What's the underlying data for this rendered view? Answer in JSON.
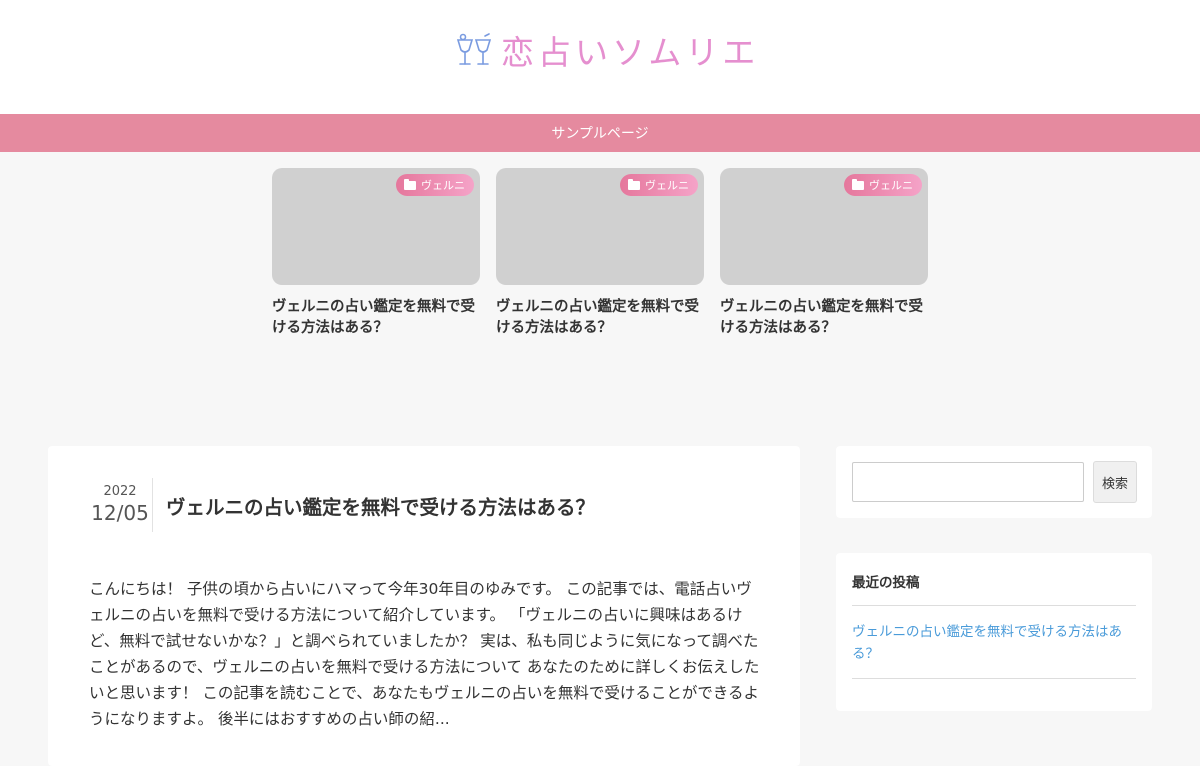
{
  "header": {
    "logo_text": "恋占いソムリエ",
    "logo_icon": "wine-glasses-icon",
    "logo_color": "#e58fcf"
  },
  "nav": {
    "items": [
      {
        "label": "サンプルページ"
      }
    ],
    "background": "#e58a9f"
  },
  "pickup": {
    "cards": [
      {
        "category": "ヴェルニ",
        "title": "ヴェルニの占い鑑定を無料で受ける方法はある？"
      },
      {
        "category": "ヴェルニ",
        "title": "ヴェルニの占い鑑定を無料で受ける方法はある？"
      },
      {
        "category": "ヴェルニ",
        "title": "ヴェルニの占い鑑定を無料で受ける方法はある？"
      }
    ]
  },
  "article": {
    "year": "2022",
    "month_day": "12/05",
    "title": "ヴェルニの占い鑑定を無料で受ける方法はある？",
    "excerpt": "こんにちは！ 子供の頃から占いにハマって今年30年目のゆみです。 この記事では、電話占いヴェルニの占いを無料で受ける方法について紹介しています。 「ヴェルニの占いに興味はあるけど、無料で試せないかな？」と調べられていましたか？ 実は、私も同じように気になって調べたことがあるので、ヴェルニの占いを無料で受ける方法について あなたのために詳しくお伝えしたいと思います！ この記事を読むことで、あなたもヴェルニの占いを無料で受けることができるようになりますよ。 後半にはおすすめの占い師の紹..."
  },
  "sidebar": {
    "search": {
      "placeholder": "",
      "button_label": "検索"
    },
    "recent": {
      "title": "最近の投稿",
      "posts": [
        {
          "label": "ヴェルニの占い鑑定を無料で受ける方法はある？"
        }
      ],
      "link_color": "#4a9bd9"
    }
  }
}
